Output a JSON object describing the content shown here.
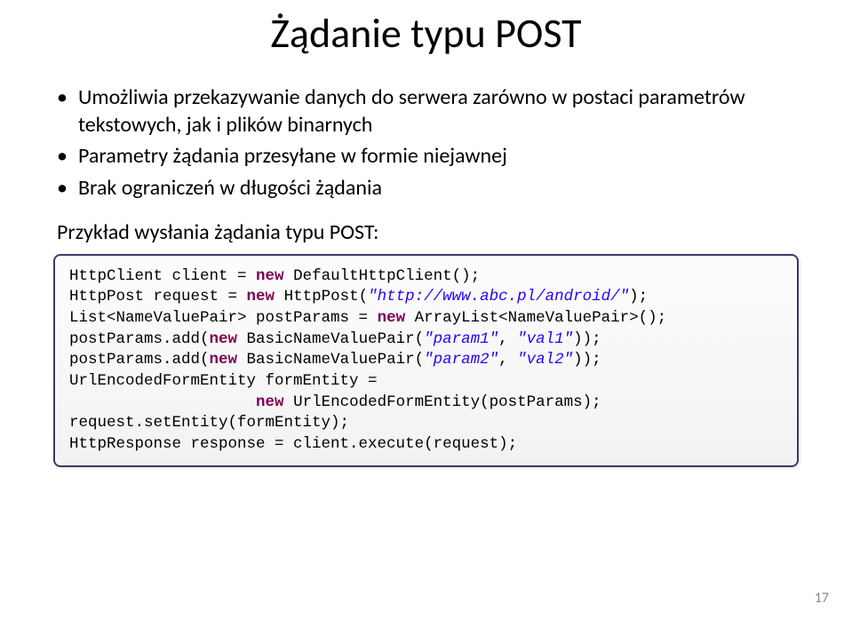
{
  "title": "Żądanie typu POST",
  "bullets": [
    "Umożliwia przekazywanie danych do serwera zarówno w postaci parametrów tekstowych, jak i plików binarnych",
    "Parametry żądania przesyłane w formie niejawnej",
    "Brak ograniczeń w długości żądania"
  ],
  "example_label": "Przykład wysłania żądania typu POST:",
  "code": {
    "l1a": "HttpClient client = ",
    "l1b": "new",
    "l1c": " DefaultHttpClient();",
    "l2a": "HttpPost request = ",
    "l2b": "new",
    "l2c": " HttpPost(",
    "l2d": "\"http://www.abc.pl/android/\"",
    "l2e": ");",
    "l3a": "List<NameValuePair> postParams = ",
    "l3b": "new",
    "l3c": " ArrayList<NameValuePair>();",
    "l4a": "postParams.add(",
    "l4b": "new",
    "l4c": " BasicNameValuePair(",
    "l4d": "\"param1\"",
    "l4e": ", ",
    "l4f": "\"val1\"",
    "l4g": "));",
    "l5a": "postParams.add(",
    "l5b": "new",
    "l5c": " BasicNameValuePair(",
    "l5d": "\"param2\"",
    "l5e": ", ",
    "l5f": "\"val2\"",
    "l5g": "));",
    "l6": "UrlEncodedFormEntity formEntity =",
    "l7a": "                    ",
    "l7b": "new",
    "l7c": " UrlEncodedFormEntity(postParams);",
    "l8": "request.setEntity(formEntity);",
    "l9": "HttpResponse response = client.execute(request);"
  },
  "page_number": "17"
}
